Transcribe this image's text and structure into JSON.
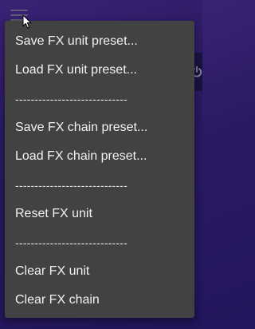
{
  "menu": {
    "items": [
      {
        "type": "item",
        "label": "Save FX unit preset..."
      },
      {
        "type": "item",
        "label": "Load FX unit preset..."
      },
      {
        "type": "separator",
        "label": "-----------------------------"
      },
      {
        "type": "item",
        "label": "Save FX chain preset..."
      },
      {
        "type": "item",
        "label": "Load FX chain preset..."
      },
      {
        "type": "separator",
        "label": "-----------------------------"
      },
      {
        "type": "item",
        "label": "Reset FX unit"
      },
      {
        "type": "separator",
        "label": "-----------------------------"
      },
      {
        "type": "item",
        "label": "Clear FX unit"
      },
      {
        "type": "item",
        "label": "Clear FX chain"
      }
    ]
  },
  "icons": {
    "menu": "hamburger-icon",
    "power": "power-icon",
    "cursor": "mouse-pointer-icon"
  },
  "colors": {
    "background": "#2a1a62",
    "menu_background": "#424242",
    "menu_text": "#f2f2f2"
  }
}
